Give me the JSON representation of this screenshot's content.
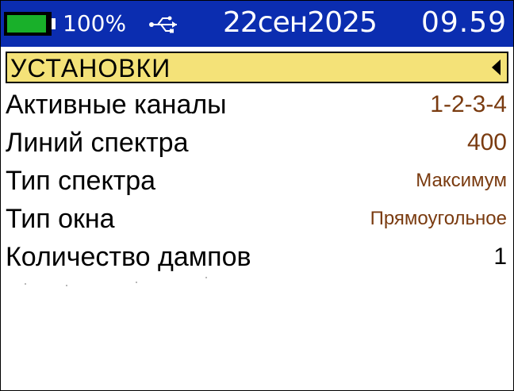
{
  "status_bar": {
    "battery_level": 0.95,
    "battery_percent": "100%",
    "battery_color": "#19b02a",
    "usb_icon": "usb-icon",
    "date": "22сен2025",
    "time": "09.59",
    "background": "#0b2db0"
  },
  "header": {
    "title": "УСТАНОВКИ",
    "background": "#f4e278",
    "arrow_icon": "triangle-left-icon"
  },
  "settings": [
    {
      "label": "Активные каналы",
      "value": "1-2-3-4"
    },
    {
      "label": "Линий спектра",
      "value": "400"
    },
    {
      "label": "Тип спектра",
      "value": "Максимум"
    },
    {
      "label": "Тип окна",
      "value": "Прямоугольное"
    },
    {
      "label": "Количество дампов",
      "value": "1"
    }
  ],
  "colors": {
    "value_text": "#7a3b10",
    "label_text": "#000000"
  }
}
